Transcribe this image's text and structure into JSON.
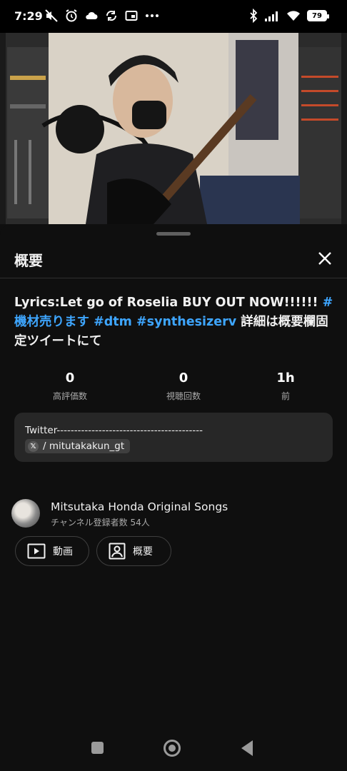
{
  "status_bar": {
    "time": "7:29",
    "battery": "79"
  },
  "video": {
    "progress_fraction": 0
  },
  "sheet": {
    "title": "概要",
    "description": {
      "text_1": "Lyrics:Let go of Roselia BUY OUT NOW!!!!!! ",
      "hashtag_1": "#機材売ります",
      "hashtag_2": "#dtm",
      "hashtag_3": "#synthesizerv",
      "text_2": " 詳細は概要欄固定ツイートにて"
    },
    "stats": [
      {
        "value": "0",
        "label": "高評価数"
      },
      {
        "value": "0",
        "label": "視聴回数"
      },
      {
        "value": "1h",
        "label": "前"
      }
    ],
    "card": {
      "text": "Twitter------------------------------------------",
      "chip_text": "/ mitutakakun_gt"
    },
    "channel": {
      "name": "Mitsutaka Honda Original Songs",
      "subscribers": "チャンネル登録者数 54人"
    },
    "buttons": {
      "videos": "動画",
      "about": "概要"
    }
  }
}
